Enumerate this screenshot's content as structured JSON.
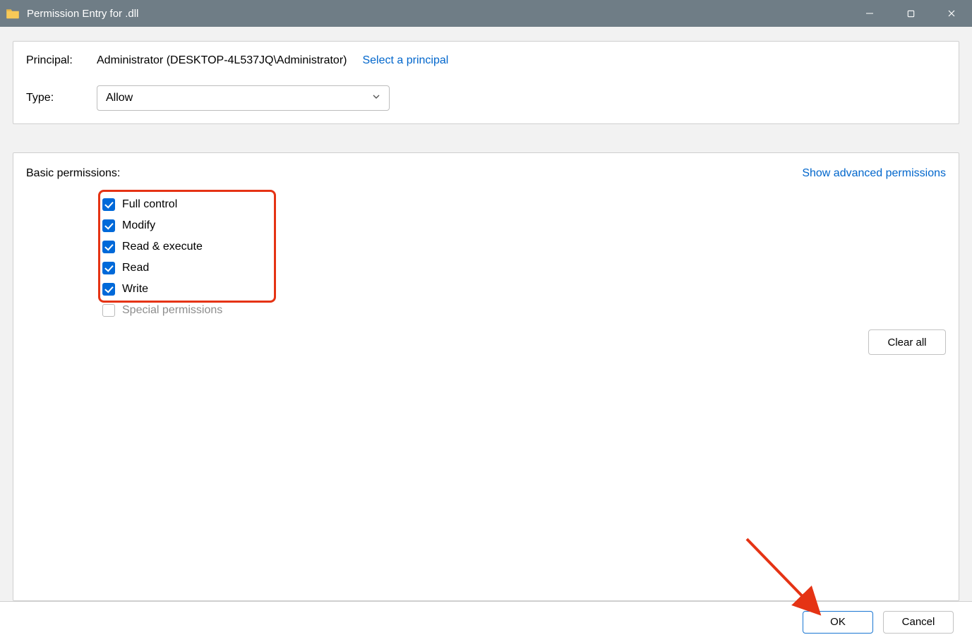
{
  "titlebar": {
    "text": "Permission Entry for         .dll"
  },
  "form": {
    "principal_label": "Principal:",
    "principal_value": "Administrator (DESKTOP-4L537JQ\\Administrator)",
    "select_principal_link": "Select a principal",
    "type_label": "Type:",
    "type_value": "Allow"
  },
  "permissions": {
    "header": "Basic permissions:",
    "advanced_link": "Show advanced permissions",
    "items": [
      {
        "label": "Full control",
        "checked": true,
        "enabled": true
      },
      {
        "label": "Modify",
        "checked": true,
        "enabled": true
      },
      {
        "label": "Read & execute",
        "checked": true,
        "enabled": true
      },
      {
        "label": "Read",
        "checked": true,
        "enabled": true
      },
      {
        "label": "Write",
        "checked": true,
        "enabled": true
      },
      {
        "label": "Special permissions",
        "checked": false,
        "enabled": false
      }
    ],
    "clear_all": "Clear all"
  },
  "footer": {
    "ok": "OK",
    "cancel": "Cancel"
  },
  "annotation": {
    "highlight_color": "#e53314"
  }
}
